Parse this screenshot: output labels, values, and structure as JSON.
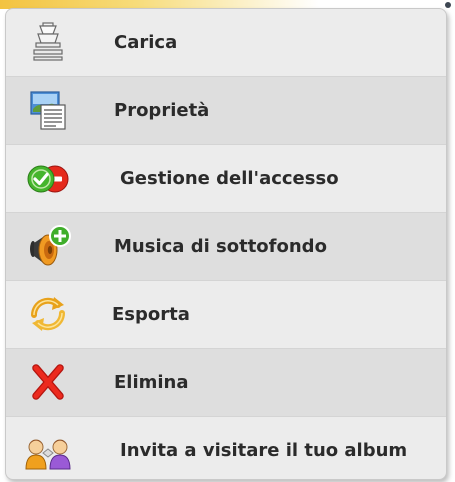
{
  "menu": {
    "items": [
      {
        "label": "Carica",
        "icon": "upload-icon"
      },
      {
        "label": "Proprietà",
        "icon": "properties-icon"
      },
      {
        "label": "Gestione dell'accesso",
        "icon": "access-management-icon"
      },
      {
        "label": "Musica di sottofondo",
        "icon": "background-music-icon"
      },
      {
        "label": "Esporta",
        "icon": "export-icon"
      },
      {
        "label": "Elimina",
        "icon": "delete-icon"
      },
      {
        "label": "Invita a visitare il tuo album",
        "icon": "invite-users-icon"
      }
    ]
  },
  "colors": {
    "menu_background": "#ececec",
    "alt_row_background": "#dedede",
    "text": "#2b2b2b",
    "delete_red": "#e8261c",
    "access_green": "#3db02a",
    "top_strip_yellow": "#f3c340"
  }
}
